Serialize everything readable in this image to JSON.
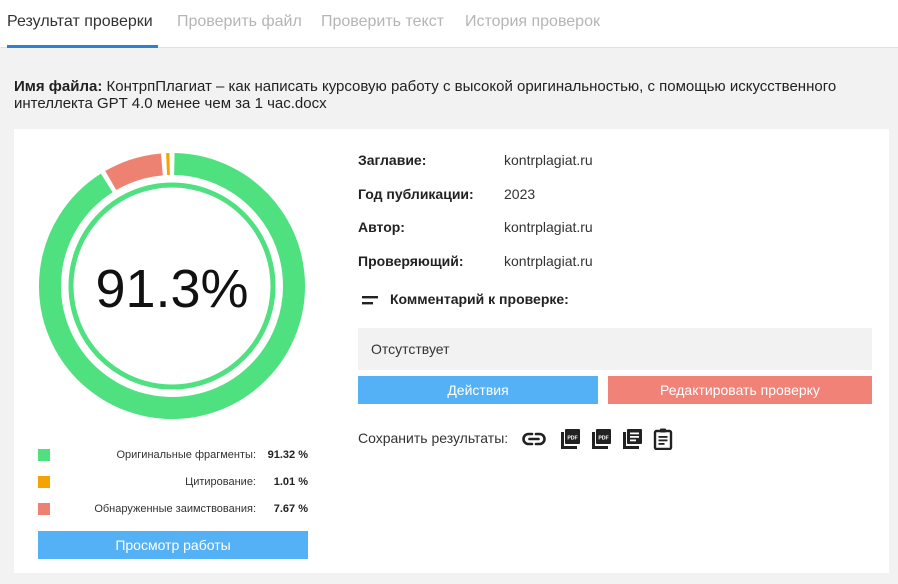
{
  "tabs": [
    {
      "label": "Результат проверки",
      "active": true
    },
    {
      "label": "Проверить файл",
      "active": false
    },
    {
      "label": "Проверить текст",
      "active": false
    },
    {
      "label": "История проверок",
      "active": false
    }
  ],
  "file": {
    "label": "Имя файла:",
    "name": "КонтрпПлагиат – как написать курсовую работу с высокой оригинальностью, с помощью искусственного интеллекта GPT 4.0 менее чем за 1 час.docx"
  },
  "result": {
    "score": "91.3%",
    "score_fraction": 0.913,
    "legend": [
      {
        "label": "Оригинальные фрагменты:",
        "value": "91.32 %",
        "color": "#4fe080",
        "fraction": 0.9132
      },
      {
        "label": "Цитирование:",
        "value": "1.01 %",
        "color": "#f5a300",
        "fraction": 0.0101
      },
      {
        "label": "Обнаруженные заимствования:",
        "value": "7.67 %",
        "color": "#ee8272",
        "fraction": 0.0767
      }
    ],
    "view_button": "Просмотр работы"
  },
  "meta": {
    "title_label": "Заглавие:",
    "title_value": "kontrplagiat.ru",
    "year_label": "Год публикации:",
    "year_value": "2023",
    "author_label": "Автор:",
    "author_value": "kontrplagiat.ru",
    "checker_label": "Проверяющий:",
    "checker_value": "kontrplagiat.ru"
  },
  "comment": {
    "label": "Комментарий к проверке:",
    "text": "Отсутствует"
  },
  "actions": {
    "actions_button": "Действия",
    "edit_button": "Редактировать проверку"
  },
  "save": {
    "label": "Сохранить результаты:",
    "icons": [
      "link-icon",
      "pdf-icon",
      "pdf-icon",
      "report-icon",
      "document-icon"
    ]
  },
  "colors": {
    "accent": "#2f80d1",
    "button_blue": "#54b1f5",
    "button_red": "#f08277",
    "original": "#4fe080",
    "citation": "#f5a300",
    "borrowed": "#ee8272"
  }
}
